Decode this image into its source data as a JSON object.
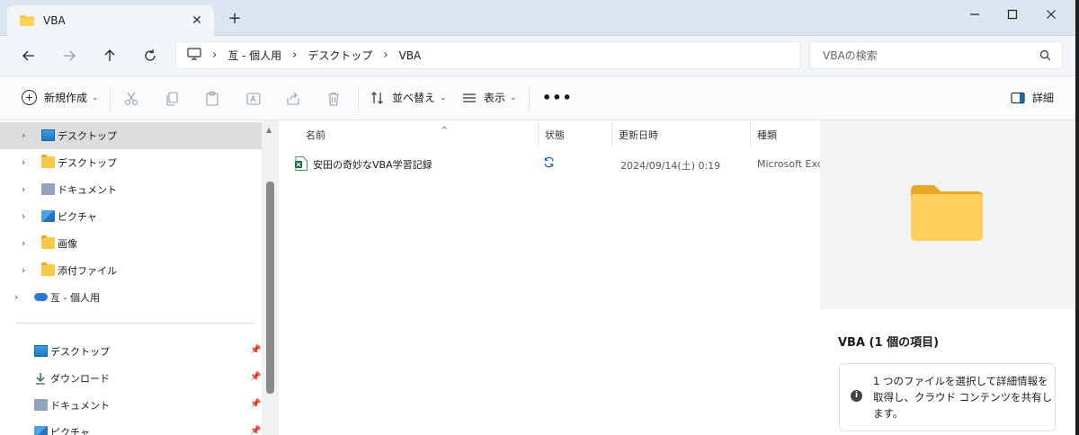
{
  "window": {
    "tab_title": "VBA",
    "new_tab_symbol": "+",
    "close_tab_symbol": "✕"
  },
  "nav": {
    "breadcrumbs": [
      "亙 - 個人用",
      "デスクトップ",
      "VBA"
    ],
    "search_placeholder": "VBAの検索"
  },
  "toolbar": {
    "new_label": "新規作成",
    "sort_label": "並べ替え",
    "view_label": "表示",
    "more_label": "•••",
    "details_label": "詳細"
  },
  "sidebar": {
    "items": [
      {
        "label": "デスクトップ",
        "icon": "desktop-icon",
        "selected": true
      },
      {
        "label": "デスクトップ",
        "icon": "folder-icon"
      },
      {
        "label": "ドキュメント",
        "icon": "document-icon"
      },
      {
        "label": "ピクチャ",
        "icon": "pictures-icon"
      },
      {
        "label": "画像",
        "icon": "folder-icon"
      },
      {
        "label": "添付ファイル",
        "icon": "folder-icon"
      },
      {
        "label": "亙 - 個人用",
        "icon": "onedrive-icon"
      }
    ],
    "pinned": [
      {
        "label": "デスクトップ",
        "icon": "desktop-icon"
      },
      {
        "label": "ダウンロード",
        "icon": "download-icon"
      },
      {
        "label": "ドキュメント",
        "icon": "document-icon"
      },
      {
        "label": "ピクチャ",
        "icon": "pictures-icon"
      }
    ]
  },
  "filelist": {
    "columns": [
      "名前",
      "状態",
      "更新日時",
      "種類"
    ],
    "rows": [
      {
        "name": "安田の奇妙なVBA学習記録",
        "status": "sync-icon",
        "modified": "2024/09/14(土) 0:19",
        "type": "Microsoft Excel"
      }
    ]
  },
  "details": {
    "title": "VBA (1 個の項目)",
    "info": "1 つのファイルを選択して詳細情報を取得し、クラウド コンテンツを共有します。"
  },
  "colors": {
    "titlebar": "#dce6f0",
    "folder": "#f7c948",
    "excel": "#1d6f42",
    "sync": "#0f6cbd"
  }
}
